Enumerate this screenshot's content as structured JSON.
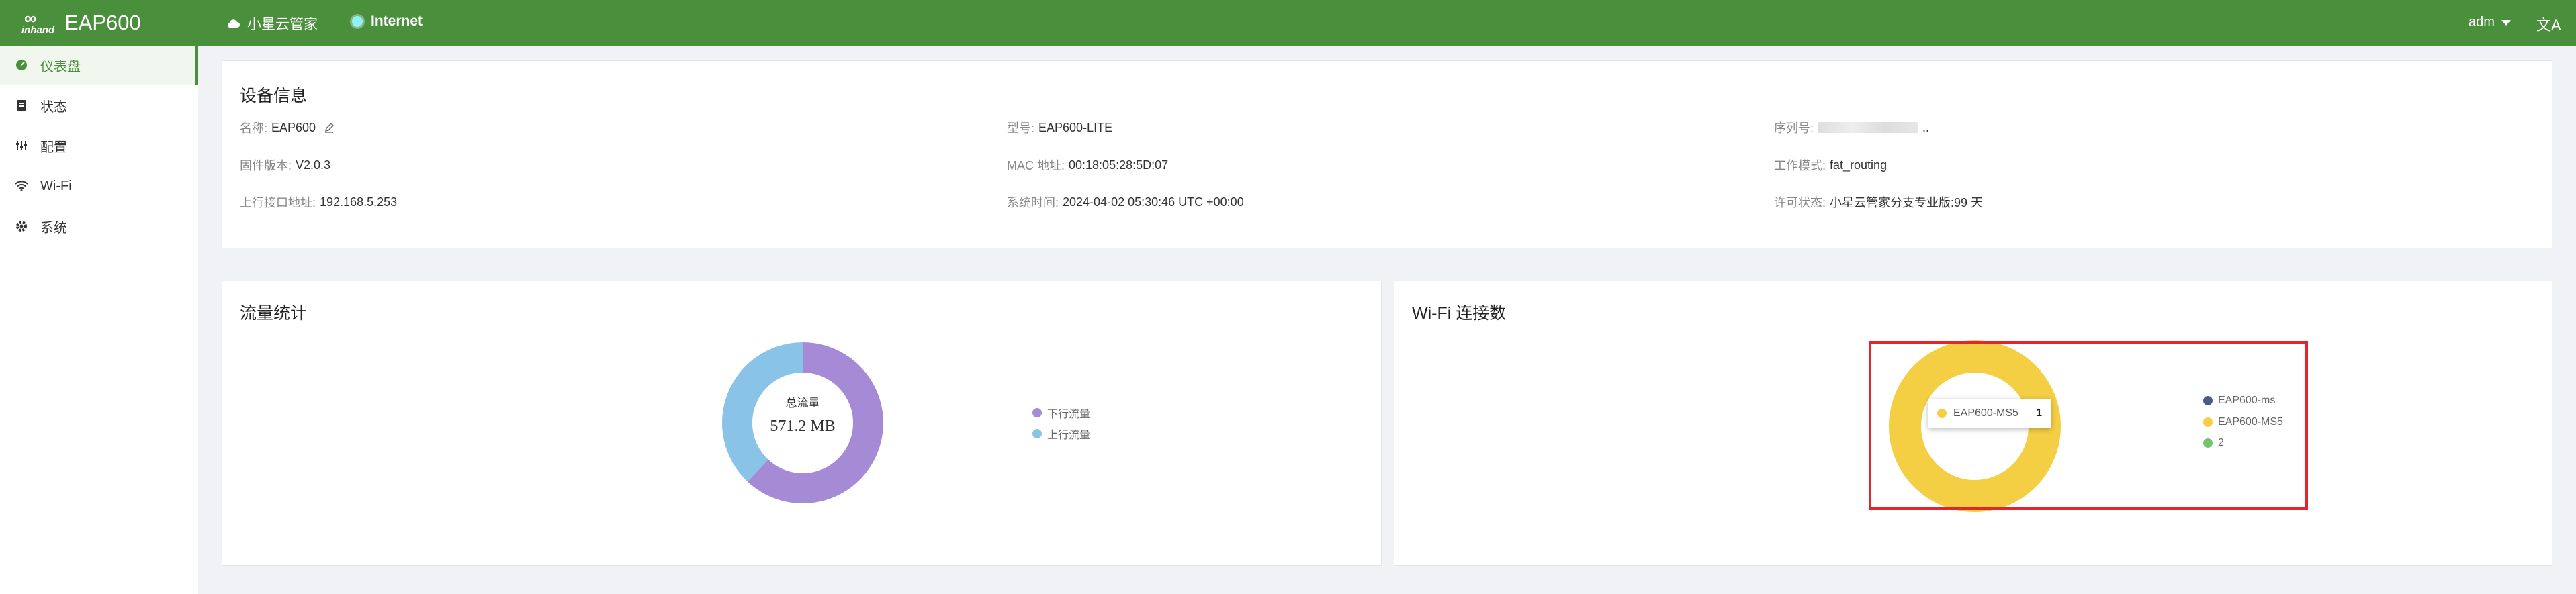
{
  "header": {
    "logo_top": "∞",
    "logo_brand": "inhand",
    "app_name": "EAP600",
    "cloud_label": "小星云管家",
    "internet_label": "Internet",
    "user": "adm",
    "lang_icon": "文A"
  },
  "sidebar": {
    "items": [
      {
        "label": "仪表盘",
        "icon": "dashboard-icon"
      },
      {
        "label": "状态",
        "icon": "status-icon"
      },
      {
        "label": "配置",
        "icon": "config-icon"
      },
      {
        "label": "Wi-Fi",
        "icon": "wifi-icon"
      },
      {
        "label": "系统",
        "icon": "gear-icon"
      }
    ]
  },
  "device_info": {
    "title": "设备信息",
    "name_label": "名称:",
    "name_value": "EAP600",
    "model_label": "型号:",
    "model_value": "EAP600-LITE",
    "serial_label": "序列号:",
    "serial_suffix": "..",
    "firmware_label": "固件版本:",
    "firmware_value": "V2.0.3",
    "mac_label": "MAC 地址:",
    "mac_value": "00:18:05:28:5D:07",
    "mode_label": "工作模式:",
    "mode_value": "fat_routing",
    "uplink_label": "上行接口地址:",
    "uplink_value": "192.168.5.253",
    "time_label": "系统时间:",
    "time_value": "2024-04-02 05:30:46 UTC +00:00",
    "license_label": "许可状态:",
    "license_value": "小星云管家分支专业版:99 天"
  },
  "traffic": {
    "title": "流量统计",
    "center_label": "总流量",
    "center_value": "571.2 MB",
    "colors": {
      "down": "#a58bd6",
      "up": "#8ac3e8"
    }
  },
  "wifi_clients": {
    "title": "Wi-Fi 连接数",
    "tooltip_name": "EAP600-MS5",
    "tooltip_value": "1",
    "colors": {
      "ms": "#4e5a86",
      "ms5": "#f4cf44",
      "two": "#75c46d"
    }
  },
  "chart_data": [
    {
      "type": "pie",
      "title": "流量统计",
      "center_label": "总流量",
      "center_value": "571.2 MB",
      "labels": [
        "下行流量",
        "上行流量"
      ],
      "values": [
        62,
        38
      ],
      "colors": [
        "#a58bd6",
        "#8ac3e8"
      ],
      "legend": "right"
    },
    {
      "type": "pie",
      "title": "Wi-Fi 连接数",
      "labels": [
        "EAP600-ms",
        "EAP600-MS5",
        "2"
      ],
      "values": [
        0,
        1,
        0
      ],
      "colors": [
        "#4e5a86",
        "#f4cf44",
        "#75c46d"
      ],
      "legend": "right"
    }
  ]
}
